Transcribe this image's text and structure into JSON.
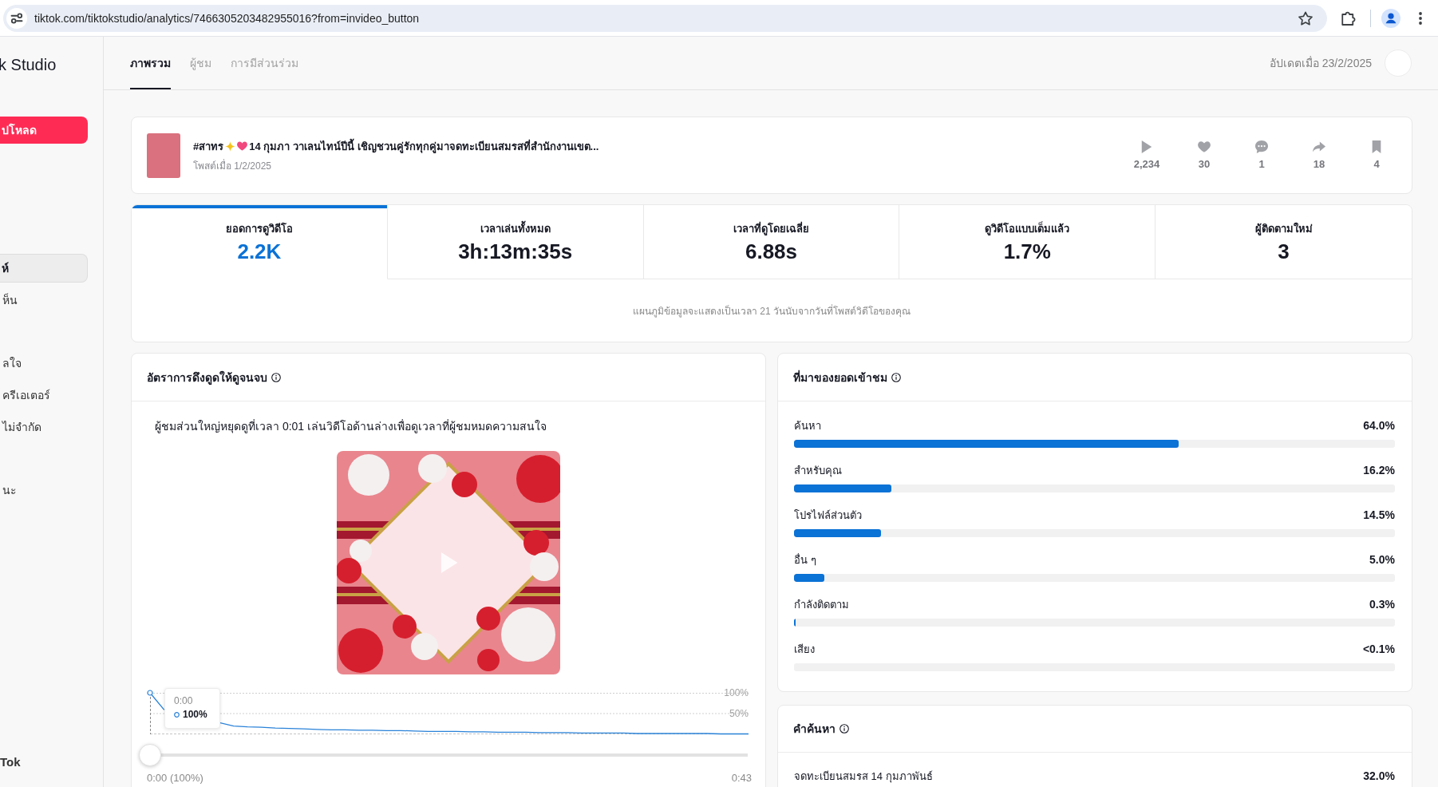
{
  "browser": {
    "url": "tiktok.com/tiktokstudio/analytics/7466305203482955016?from=invideo_button"
  },
  "sidebar": {
    "brand": "k Studio",
    "upload_button": "ปโหลด",
    "sections": [
      {
        "items": [
          {
            "label": "ห์",
            "selected": true
          },
          {
            "label": "ห็น",
            "selected": false
          }
        ]
      },
      {
        "items": [
          {
            "label": "ลใจ",
            "selected": false
          },
          {
            "label": "ครีเอเตอร์",
            "selected": false
          },
          {
            "label": "ไม่จำกัด",
            "selected": false
          }
        ]
      },
      {
        "items": [
          {
            "label": "นะ",
            "selected": false
          }
        ]
      }
    ],
    "footer": "Tok"
  },
  "header": {
    "tabs": [
      {
        "label": "ภาพรวม",
        "selected": true
      },
      {
        "label": "ผู้ชม",
        "selected": false
      },
      {
        "label": "การมีส่วนร่วม",
        "selected": false
      }
    ],
    "updated": "อัปเดตเมื่อ 23/2/2025"
  },
  "video": {
    "hashtag": "#สาทร",
    "caption": "14 กุมภา วาเลนไทน์ปีนี้ เชิญชวนคู่รักทุกคู่มาจดทะเบียนสมรสที่สำนักงานเขต...",
    "posted": "โพสต์เมื่อ 1/2/2025",
    "stats": [
      {
        "kind": "play",
        "count": "2,234"
      },
      {
        "kind": "like",
        "count": "30"
      },
      {
        "kind": "comment",
        "count": "1"
      },
      {
        "kind": "share",
        "count": "18"
      },
      {
        "kind": "save",
        "count": "4"
      }
    ]
  },
  "metrics": {
    "tabs": [
      {
        "label": "ยอดการดูวิดีโอ",
        "value": "2.2K",
        "selected": true
      },
      {
        "label": "เวลาเล่นทั้งหมด",
        "value": "3h:13m:35s",
        "selected": false
      },
      {
        "label": "เวลาที่ดูโดยเฉลี่ย",
        "value": "6.88s",
        "selected": false
      },
      {
        "label": "ดูวิดีโอแบบเต็มแล้ว",
        "value": "1.7%",
        "selected": false
      },
      {
        "label": "ผู้ติดตามใหม่",
        "value": "3",
        "selected": false
      }
    ],
    "note": "แผนภูมิข้อมูลจะแสดงเป็นเวลา 21 วันนับจากวันที่โพสต์วิดีโอของคุณ"
  },
  "retention": {
    "title": "อัตราการดึงดูดให้ดูจนจบ",
    "summary": "ผู้ชมส่วนใหญ่หยุดดูที่เวลา 0:01 เล่นวิดีโอด้านล่างเพื่อดูเวลาที่ผู้ชมหมดความสนใจ",
    "chart_data": {
      "type": "line",
      "categories": [
        null,
        null,
        null,
        null,
        null,
        null,
        null,
        null,
        null,
        null,
        null,
        null,
        null,
        null,
        null,
        null,
        null,
        null,
        null,
        null,
        null,
        null,
        null,
        null,
        null,
        null,
        null,
        null,
        null,
        null,
        null,
        null,
        null,
        null,
        null,
        null,
        null,
        null,
        null,
        null,
        null,
        null,
        null,
        null
      ],
      "values": [
        100,
        60,
        null,
        null,
        null,
        null,
        20,
        18,
        17,
        15,
        14,
        13,
        12,
        11,
        11,
        10,
        10,
        9,
        9,
        8,
        7,
        7,
        7,
        6,
        6,
        5,
        5,
        5,
        4,
        4,
        4,
        3,
        3,
        3,
        3,
        2,
        2,
        2,
        2,
        2,
        2,
        1,
        1,
        1
      ],
      "ylim": [
        0,
        100
      ],
      "yticks": [
        {
          "value": 50,
          "label": "50%"
        },
        {
          "value": 100,
          "label": "100%"
        }
      ]
    },
    "tooltip": {
      "time": "0:00",
      "value": "100%"
    },
    "slider": {
      "level": 0,
      "start_label": "0:00 (100%)",
      "end_label": "0:43"
    }
  },
  "traffic_sources": {
    "title": "ที่มาของยอดเข้าชม",
    "rows": [
      {
        "label": "ค้นหา",
        "value": "64.0%",
        "level": 0.64
      },
      {
        "label": "สำหรับคุณ",
        "value": "16.2%",
        "level": 0.162
      },
      {
        "label": "โปรไฟล์ส่วนตัว",
        "value": "14.5%",
        "level": 0.145
      },
      {
        "label": "อื่น ๆ",
        "value": "5.0%",
        "level": 0.05
      },
      {
        "label": "กำลังติดตาม",
        "value": "0.3%",
        "level": 0.003
      },
      {
        "label": "เสียง",
        "value": "<0.1%"
      }
    ]
  },
  "search_terms": {
    "title": "คำค้นหา",
    "rows": [
      {
        "label": "จดทะเบียนสมรส 14 กุมภาพันธ์",
        "value": "32.0%"
      }
    ]
  }
}
